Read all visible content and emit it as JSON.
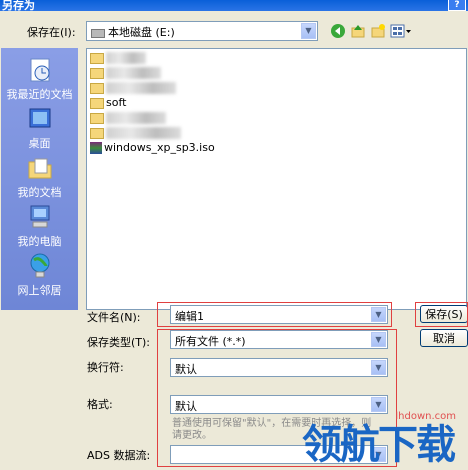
{
  "window": {
    "title": "另存为",
    "help_label": "?"
  },
  "toolbar": {
    "lookin_label": "保存在(I):",
    "lookin_value": "本地磁盘 (E:)",
    "icons": [
      "back-icon",
      "up-folder-icon",
      "new-folder-icon",
      "views-menu-icon"
    ]
  },
  "places": [
    {
      "label": "我最近的文档",
      "icon": "recent-documents-icon"
    },
    {
      "label": "桌面",
      "icon": "desktop-icon"
    },
    {
      "label": "我的文档",
      "icon": "my-documents-icon"
    },
    {
      "label": "我的电脑",
      "icon": "my-computer-icon"
    },
    {
      "label": "网上邻居",
      "icon": "network-places-icon"
    }
  ],
  "files": [
    {
      "name": "soft"
    },
    {
      "name": "windows_xp_sp3.iso"
    }
  ],
  "form": {
    "filename_label": "文件名(N):",
    "filename_value": "编辑1",
    "savetype_label": "保存类型(T):",
    "savetype_value": "所有文件 (*.*)",
    "newline_label": "换行符:",
    "newline_value": "默认",
    "format_label": "格式:",
    "format_value": "默认",
    "format_hint": "普通使用可保留\"默认\"，在需要时再选择，则请更改。",
    "ads_label": "ADS 数据流:"
  },
  "buttons": {
    "save": "保存(S)",
    "cancel": "取消"
  },
  "watermark": {
    "text": "领航下载",
    "url": "lhdown.com"
  }
}
